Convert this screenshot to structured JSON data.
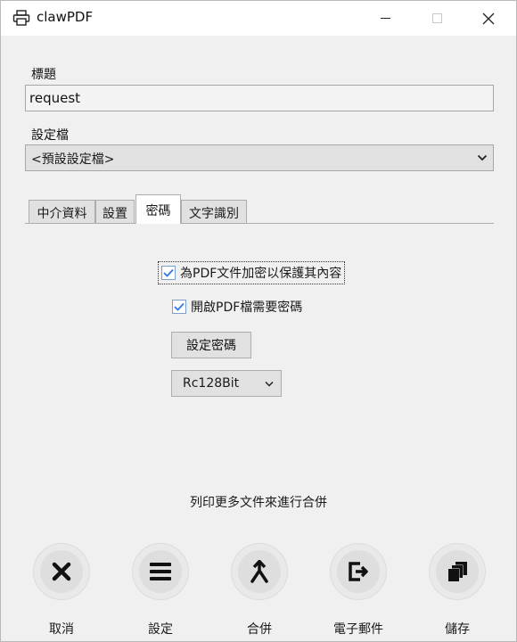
{
  "window": {
    "title": "clawPDF"
  },
  "form": {
    "title_label": "標題",
    "title_value": "request",
    "profile_label": "設定檔",
    "profile_value": "<預設設定檔>"
  },
  "tabs": [
    {
      "label": "中介資料",
      "active": false
    },
    {
      "label": "設置",
      "active": false
    },
    {
      "label": "密碼",
      "active": true
    },
    {
      "label": "文字識別",
      "active": false
    }
  ],
  "security": {
    "encrypt_label": "為PDF文件加密以保護其內容",
    "encrypt_checked": true,
    "require_password_label": "開啟PDF檔需要密碼",
    "require_password_checked": true,
    "set_password_button": "設定密碼",
    "encryption_level": "Rc128Bit"
  },
  "merge_hint": "列印更多文件來進行合併",
  "actions": [
    {
      "label": "取消",
      "icon": "x-icon"
    },
    {
      "label": "設定",
      "icon": "menu-icon"
    },
    {
      "label": "合併",
      "icon": "merge-icon"
    },
    {
      "label": "電子郵件",
      "icon": "email-export-icon"
    },
    {
      "label": "儲存",
      "icon": "save-copies-icon"
    }
  ],
  "colors": {
    "checkbox_check": "#2a7ae2",
    "window_bg": "#f0f0f0"
  }
}
